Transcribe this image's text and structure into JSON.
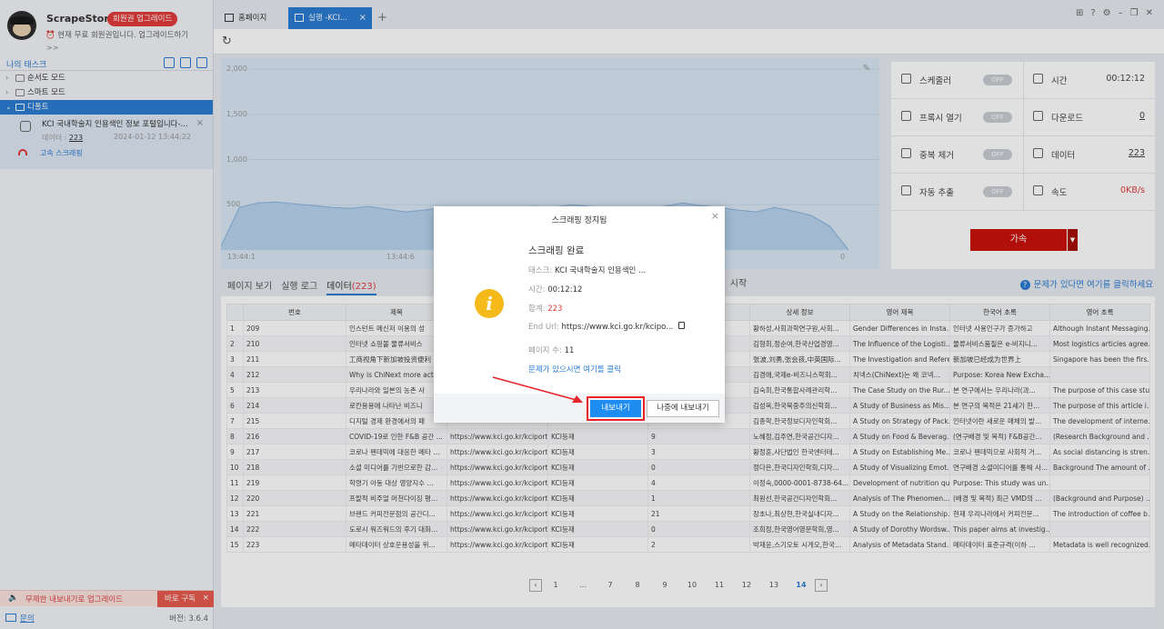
{
  "app": {
    "name": "ScrapeStorm",
    "upgrade_badge": "회원권 업그레이드",
    "member_msg": "현재 무료 회원권입니다. 업그레이드하기",
    "more": ">>"
  },
  "sidebar": {
    "my_tasks": "나의 태스크",
    "items": [
      {
        "label": "순서도 모드"
      },
      {
        "label": "스마트 모드"
      },
      {
        "label": "디폴트"
      }
    ],
    "task": {
      "title": "KCI 국내학술지 인용색인 정보 포털입니다-...",
      "data_label": "데이터 :",
      "data_count": "223",
      "date": "2024-01-12 13:44:22",
      "speed_link": "고속 스크래핑"
    },
    "promo": {
      "text": "무제한 내보내기로 업그레이드",
      "button": "바로 구독"
    },
    "help": "문의",
    "version": "버전: 3.6.4"
  },
  "tabs": {
    "home": "홈페이지",
    "run": "실행 -KCI..."
  },
  "chart_data": {
    "type": "area",
    "title": "",
    "xlabel": "",
    "ylabel": "",
    "ylim": [
      0,
      2000
    ],
    "yticks": [
      "2,000",
      "1,500",
      "1,000",
      "500"
    ],
    "x_ticks": [
      "13:44:1",
      "13:44:6",
      "0"
    ],
    "values": [
      40,
      470,
      520,
      530,
      510,
      490,
      470,
      460,
      480,
      450,
      420,
      440,
      470,
      460,
      430,
      460,
      470,
      480,
      470,
      500,
      480,
      450,
      470,
      460,
      480,
      520,
      490,
      470,
      440,
      420,
      470,
      430,
      380,
      260,
      0
    ]
  },
  "stats": {
    "scheduler": "스케줄러",
    "scheduler_state": "OFF",
    "time_label": "시간",
    "time_value": "00:12:12",
    "browser": "프록시 열기",
    "browser_state": "OFF",
    "download_label": "다운로드",
    "download_value": "0",
    "dedup": "중복 제거",
    "dedup_state": "OFF",
    "data_label": "데이터",
    "data_value": "223",
    "auto_extract": "자동 추출",
    "auto_extract_state": "OFF",
    "speed_label": "속도",
    "speed_value": "0KB/s",
    "accelerate": "가속"
  },
  "data_tabs": {
    "page_view": "페이지 보기",
    "run_log": "실행 로그",
    "data": "데이터",
    "data_count": "(223)",
    "start": "시작",
    "help_link": "문제가 있다면 여기를 클릭하세요"
  },
  "table": {
    "headers": [
      "",
      "번호",
      "제목",
      "",
      "",
      "",
      "상세 정보",
      "영어 제목",
      "한국어 초록",
      "영어 초록"
    ],
    "rows": [
      [
        "1",
        "209",
        "인스턴트 메신저 이용의 성",
        "",
        "",
        "",
        "황하성,사회과학연구원,사회...",
        "Gender Differences in Insta...",
        "인터넷 사용인구가 증가하고",
        "Although Instant Messaging..."
      ],
      [
        "2",
        "210",
        "인터넷 쇼핑몰 물류서비스",
        "",
        "",
        "",
        "김형희,정순여,한국산업경영...",
        "The Influence of the Logisti...",
        "물류서비스품질은 e-비지니...",
        "Most logistics articles agree..."
      ],
      [
        "3",
        "211",
        "工商视角下新加坡投资便利",
        "",
        "",
        "",
        "张波,刘勇,张会孩,中英国际...",
        "The Investigation and Refere...",
        "新加坡已经成为世界上",
        "Singapore has been the firs..."
      ],
      [
        "4",
        "212",
        "Why is ChiNext more activ",
        "",
        "",
        "",
        "김경애,국제e-비즈니스학회...",
        "치넥스(ChiNext)는 왜 코넥...",
        "Purpose: Korea New Excha...",
        ""
      ],
      [
        "5",
        "213",
        "우리나라와 일본의 농촌 사",
        "",
        "",
        "",
        "김숙희,한국통합사례관리학...",
        "The Case Study on the Rur...",
        "본 연구에서는 우리나라(과...",
        "The purpose of this case stu..."
      ],
      [
        "6",
        "214",
        "로칸용용에 나타난 비즈니",
        "",
        "",
        "",
        "김성옥,한국북중주의신학회...",
        "A Study of Business as Mis...",
        "본 연구의 목적은 21세기 한...",
        "The purpose of this article i..."
      ],
      [
        "7",
        "215",
        "디지털 경제 환경에서의 패",
        "",
        "",
        "",
        "김종학,한국정보디자인학회...",
        "A Study on Strategy of Pack...",
        "인터넷이란 새로운 매체의 발...",
        "The development of interne..."
      ],
      [
        "8",
        "216",
        "COVID-19로 인한 F&B 공간 ...",
        "https://www.kci.go.kr/kciport...",
        "KCI등재",
        "9",
        "노혜정,김주연,한국공간디자...",
        "A Study on Food & Beverag...",
        "(연구배경 및 목적) F&B공간...",
        "(Research Background and ..."
      ],
      [
        "9",
        "217",
        "코로나 팬데믹에 대응한 메타 ...",
        "https://www.kci.go.kr/kciport...",
        "KCI등재",
        "3",
        "황정훈,사단법인 한국엔터테...",
        "A Study on Establishing Me...",
        "코로나 팬데믹으로 사회적 거...",
        "As social distancing is stren..."
      ],
      [
        "10",
        "218",
        "소셜 미디어를 기반으로한 감...",
        "https://www.kci.go.kr/kciport...",
        "KCI등재",
        "0",
        "정다은,한국디자인학회,디자...",
        "A Study of Visualizing Emot...",
        "연구배경 소셜미디어를 통해 사...",
        "Background The amount of ..."
      ],
      [
        "11",
        "219",
        "학령기 아동 대상 영양지수 ...",
        "https://www.kci.go.kr/kciport...",
        "KCI등재",
        "4",
        "이정숙,0000-0001-8738-64...",
        "Development of nutrition qu...",
        "Purpose: This study was un...",
        ""
      ],
      [
        "12",
        "220",
        "프랄적 비주얼 머천다이징 평...",
        "https://www.kci.go.kr/kciport...",
        "KCI등재",
        "1",
        "최원선,한국공간디자인학회...",
        "Analysis of The Phenomen...",
        "(배경 및 목적) 최근 VMD의 ...",
        "(Background and Purpose) ..."
      ],
      [
        "13",
        "221",
        "브랜드 커피전문점의 공간디...",
        "https://www.kci.go.kr/kciport...",
        "KCI등재",
        "21",
        "장초나,최상현,한국실내디자...",
        "A Study on the Relationship...",
        "현재 우리나라에서 커피전문...",
        "The introduction of coffee b..."
      ],
      [
        "14",
        "222",
        "도로시 워즈워드의 후기 대화...",
        "https://www.kci.go.kr/kciport...",
        "KCI등재",
        "0",
        "조희정,한국영어영문학회,영...",
        "A Study of Dorothy Wordsw...",
        "This paper aims at investig...",
        ""
      ],
      [
        "15",
        "223",
        "메타데이터 상호운용성을 위...",
        "https://www.kci.go.kr/kciport...",
        "KCI등재",
        "2",
        "박재윤,스기오토 시게오,한국...",
        "Analysis of Metadata Stand...",
        "메타데이터 표준규격(이하 ...",
        "Metadata is well recognized..."
      ]
    ]
  },
  "pager": {
    "pages": [
      "1",
      "...",
      "7",
      "8",
      "9",
      "10",
      "11",
      "12",
      "13",
      "14"
    ],
    "current": "14"
  },
  "dialog": {
    "title": "스크래핑 정지됨",
    "heading": "스크래핑 완료",
    "task_label": "태스크:",
    "task_value": "KCI 국내학술지 인용색인 ...",
    "time_label": "시간:",
    "time_value": "00:12:12",
    "total_label": "합계:",
    "total_value": "223",
    "end_url_label": "End Url:",
    "end_url_value": "https://www.kci.go.kr/kcipo...",
    "pages_label": "페이지 수:",
    "pages_value": "11",
    "problem_link": "문제가 있으시면 여기를 클릭",
    "export": "내보내기",
    "later": "나중에 내보내기"
  },
  "colors": {
    "accent": "#2b7cd3",
    "danger": "#e23b3b",
    "info": "#f5b91a",
    "export_btn": "#1e8cf0"
  }
}
